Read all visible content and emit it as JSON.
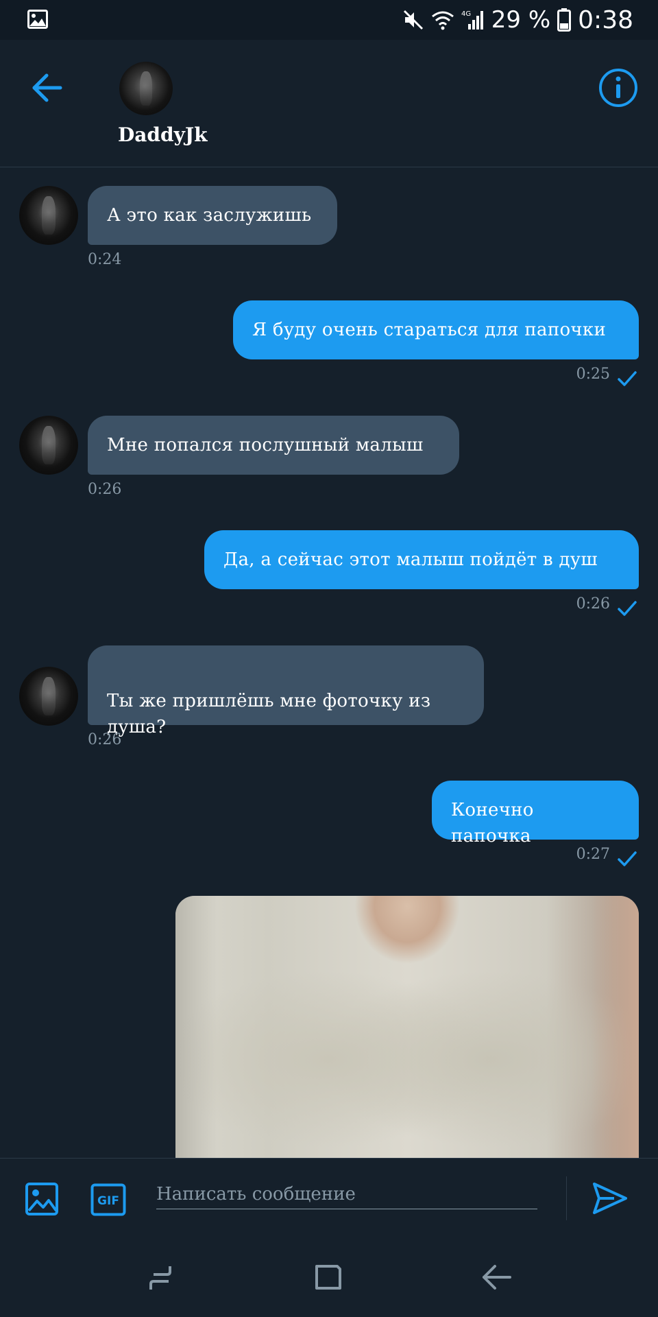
{
  "status_bar": {
    "battery_percent": "29 %",
    "clock": "0:38",
    "network": "4G",
    "icons": [
      "image-icon",
      "mute-icon",
      "wifi-icon",
      "signal-icon",
      "battery-icon"
    ]
  },
  "header": {
    "name": "DaddyJk",
    "icons": [
      "back-arrow-icon",
      "info-icon"
    ]
  },
  "messages": [
    {
      "direction": "in",
      "text": "А это как заслужишь",
      "time": "0:24"
    },
    {
      "direction": "out",
      "text": "Я буду очень стараться для папочки",
      "time": "0:25"
    },
    {
      "direction": "in",
      "text": "Мне попался послушный малыш",
      "time": "0:26"
    },
    {
      "direction": "out",
      "text": "Да, а сейчас этот малыш пойдёт в душ",
      "time": "0:26"
    },
    {
      "direction": "in",
      "text": "Ты же пришлёшь мне фоточку из\nдуша?",
      "time": "0:26"
    },
    {
      "direction": "out",
      "text": "Конечно папочка",
      "time": "0:27"
    }
  ],
  "composer": {
    "placeholder": "Написать сообщение",
    "gif_label": "GIF",
    "icons": [
      "image-icon",
      "gif-icon",
      "send-icon"
    ]
  },
  "nav": {
    "icons": [
      "recent-apps-icon",
      "home-icon",
      "back-icon"
    ]
  },
  "colors": {
    "background": "#15202b",
    "accent": "#1d9bf0",
    "incoming_bubble": "#3d5266",
    "muted_text": "#8899a6"
  }
}
